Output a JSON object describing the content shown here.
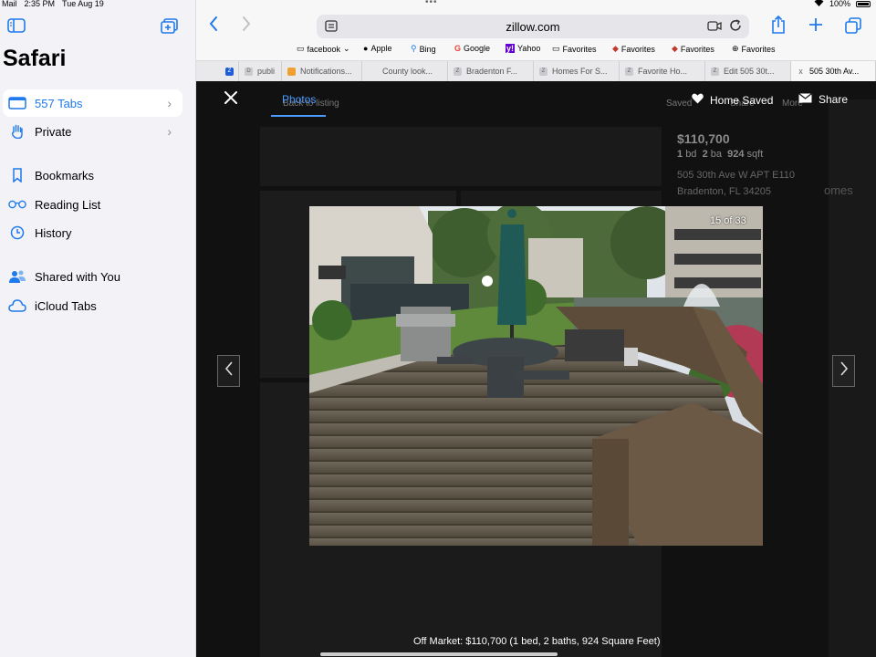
{
  "status": {
    "back_app": "Mail",
    "time": "2:35 PM",
    "date": "Tue Aug 19",
    "battery": "100%"
  },
  "sidebar": {
    "title": "Safari",
    "items": [
      {
        "label": "557 Tabs",
        "icon": "tabs-icon",
        "selected": true,
        "chevron": true
      },
      {
        "label": "Private",
        "icon": "hand-icon",
        "selected": false,
        "chevron": true
      },
      {
        "label": "Bookmarks",
        "icon": "bookmark-icon"
      },
      {
        "label": "Reading List",
        "icon": "glasses-icon"
      },
      {
        "label": "History",
        "icon": "clock-icon"
      },
      {
        "label": "Shared with You",
        "icon": "people-icon"
      },
      {
        "label": "iCloud Tabs",
        "icon": "cloud-icon"
      }
    ]
  },
  "browser": {
    "url": "zillow.com",
    "favorites": [
      {
        "label": "facebook",
        "icon": "folder-icon"
      },
      {
        "label": "Apple",
        "icon": "apple-icon"
      },
      {
        "label": "Bing",
        "icon": "search-icon"
      },
      {
        "label": "Google",
        "icon": "google-icon"
      },
      {
        "label": "Yahoo",
        "icon": "yahoo-icon"
      },
      {
        "label": "Favorites",
        "icon": "folder-icon"
      },
      {
        "label": "Favorites",
        "icon": "car-icon"
      },
      {
        "label": "Favorites",
        "icon": "car-icon"
      },
      {
        "label": "Favorites",
        "icon": "globe-icon"
      }
    ],
    "tabs": [
      {
        "label": "",
        "icon": "Z"
      },
      {
        "label": "publi",
        "icon": "D"
      },
      {
        "label": "Notifications...",
        "icon": ""
      },
      {
        "label": "County look...",
        "icon": ""
      },
      {
        "label": "Bradenton F...",
        "icon": "Z"
      },
      {
        "label": "Homes For S...",
        "icon": "Z"
      },
      {
        "label": "Favorite Ho...",
        "icon": "Z"
      },
      {
        "label": "Edit 505 30t...",
        "icon": "Z"
      },
      {
        "label": "505 30th Av...",
        "icon": "x",
        "active": true
      }
    ]
  },
  "viewer": {
    "tab_label": "Photos",
    "saved_label": "Home Saved",
    "share_label": "Share",
    "counter": "15 of 33",
    "caption": "Off Market: $110,700 (1 bed, 2 baths, 924 Square Feet)"
  },
  "background_listing": {
    "price": "$110,700",
    "beds": "1",
    "beds_unit": "bd",
    "baths": "2",
    "baths_unit": "ba",
    "sqft": "924",
    "sqft_unit": "sqft",
    "address1": "505 30th Ave W APT E110",
    "address2": "Bradenton, FL 34205",
    "back_link": "Back to listing",
    "saved": "Saved",
    "share": "Share",
    "more": "More",
    "side_text": "omes"
  }
}
